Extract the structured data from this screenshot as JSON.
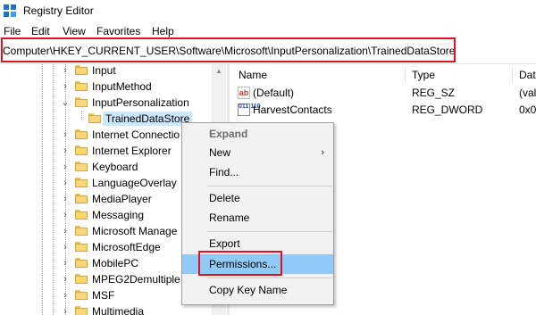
{
  "window": {
    "title": "Registry Editor"
  },
  "menu": [
    "File",
    "Edit",
    "View",
    "Favorites",
    "Help"
  ],
  "address": {
    "path": "Computer\\HKEY_CURRENT_USER\\Software\\Microsoft\\InputPersonalization\\TrainedDataStore"
  },
  "tree": {
    "items": [
      {
        "label": "Input",
        "expanded": false
      },
      {
        "label": "InputMethod",
        "expanded": false
      },
      {
        "label": "InputPersonalization",
        "expanded": true
      },
      {
        "label": "TrainedDataStore",
        "selected": true
      },
      {
        "label": "Internet Connectio",
        "expanded": false
      },
      {
        "label": "Internet Explorer",
        "expanded": false
      },
      {
        "label": "Keyboard",
        "expanded": false
      },
      {
        "label": "LanguageOverlay",
        "expanded": false
      },
      {
        "label": "MediaPlayer",
        "expanded": false
      },
      {
        "label": "Messaging",
        "expanded": false
      },
      {
        "label": "Microsoft Manage",
        "expanded": false
      },
      {
        "label": "MicrosoftEdge",
        "expanded": false
      },
      {
        "label": "MobilePC",
        "expanded": false
      },
      {
        "label": "MPEG2Demultiple",
        "expanded": false
      },
      {
        "label": "MSF",
        "expanded": false
      },
      {
        "label": "Multimedia",
        "expanded": false
      }
    ]
  },
  "values": {
    "columns": {
      "name": "Name",
      "type": "Type",
      "data": "Dat"
    },
    "rows": [
      {
        "icon": "string-value-icon",
        "name": "(Default)",
        "type": "REG_SZ",
        "data": "(val"
      },
      {
        "icon": "binary-value-icon",
        "name": "HarvestContacts",
        "type": "REG_DWORD",
        "data": "0x0"
      }
    ]
  },
  "context_menu": {
    "items": [
      {
        "label": "Expand",
        "disabled": true
      },
      {
        "label": "New",
        "submenu": true
      },
      {
        "label": "Find..."
      },
      {
        "label": "Delete"
      },
      {
        "label": "Rename"
      },
      {
        "label": "Export"
      },
      {
        "label": "Permissions...",
        "highlighted": true
      },
      {
        "label": "Copy Key Name"
      }
    ],
    "submenu_arrow": "›"
  },
  "icons": {
    "string_value": "ab",
    "binary_value": "011 110"
  },
  "colors": {
    "selection": "#cce8ff",
    "menu_highlight": "#91c9f7",
    "annotation_red": "#e0141e",
    "folder": "#f7d77a",
    "accent": "#1e73c8"
  }
}
